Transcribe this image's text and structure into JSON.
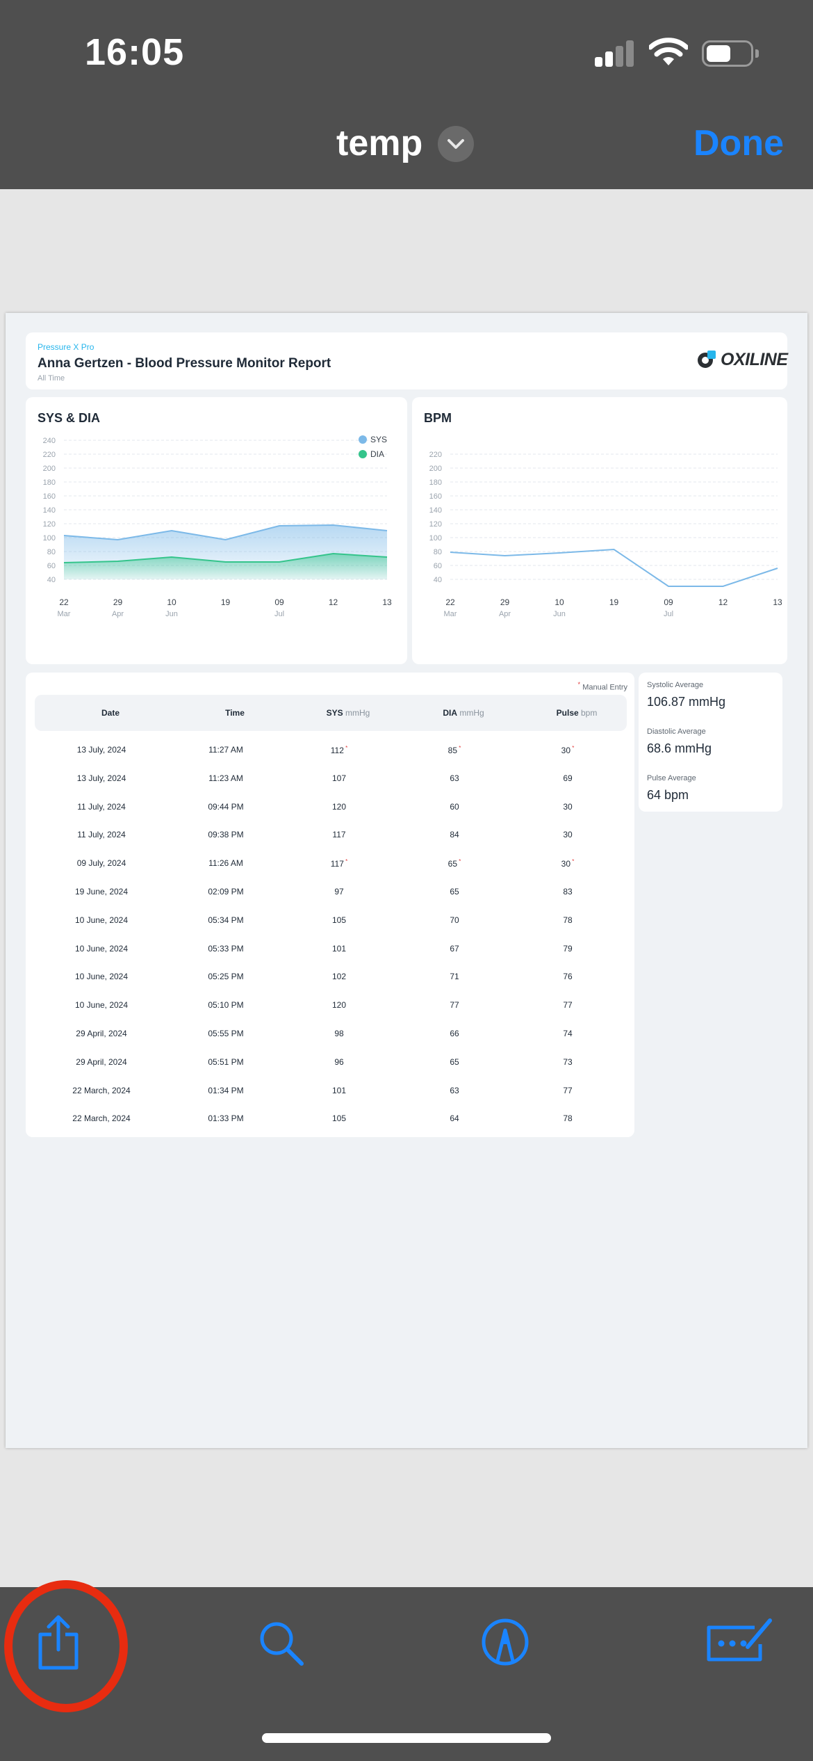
{
  "status_bar": {
    "time": "16:05"
  },
  "nav": {
    "title": "temp",
    "done_label": "Done"
  },
  "report": {
    "app_name": "Pressure X Pro",
    "title": "Anna Gertzen - Blood Pressure Monitor Report",
    "range": "All Time",
    "logo_text": "OXILINE",
    "manual_entry_note": "Manual Entry"
  },
  "chart_data": [
    {
      "type": "area",
      "title": "SYS & DIA",
      "y_ticks": [
        240,
        220,
        200,
        180,
        160,
        140,
        120,
        100,
        80,
        60,
        40
      ],
      "ylim": [
        40,
        240
      ],
      "x_ticks": [
        {
          "day": "22",
          "month": "Mar"
        },
        {
          "day": "29",
          "month": "Apr"
        },
        {
          "day": "10",
          "month": "Jun"
        },
        {
          "day": "19",
          "month": ""
        },
        {
          "day": "09",
          "month": "Jul"
        },
        {
          "day": "12",
          "month": ""
        },
        {
          "day": "13",
          "month": ""
        }
      ],
      "grid": true,
      "legend_position": "top-right",
      "series": [
        {
          "name": "SYS",
          "color": "#7cb9e8",
          "values": [
            103,
            97,
            110,
            97,
            117,
            118,
            110
          ]
        },
        {
          "name": "DIA",
          "color": "#34c48b",
          "values": [
            64,
            66,
            72,
            65,
            65,
            77,
            72
          ]
        }
      ]
    },
    {
      "type": "line",
      "title": "BPM",
      "y_ticks": [
        220,
        200,
        180,
        160,
        140,
        120,
        100,
        80,
        60,
        40
      ],
      "ylim": [
        40,
        220
      ],
      "x_ticks": [
        {
          "day": "22",
          "month": "Mar"
        },
        {
          "day": "29",
          "month": "Apr"
        },
        {
          "day": "10",
          "month": "Jun"
        },
        {
          "day": "19",
          "month": ""
        },
        {
          "day": "09",
          "month": "Jul"
        },
        {
          "day": "12",
          "month": ""
        },
        {
          "day": "13",
          "month": ""
        }
      ],
      "grid": true,
      "series": [
        {
          "color": "#7cb9e8",
          "values": [
            79,
            74,
            78,
            83,
            30,
            30,
            56
          ]
        }
      ]
    }
  ],
  "table": {
    "headers": [
      {
        "label": "Date",
        "unit": ""
      },
      {
        "label": "Time",
        "unit": ""
      },
      {
        "label": "SYS",
        "unit": "mmHg"
      },
      {
        "label": "DIA",
        "unit": "mmHg"
      },
      {
        "label": "Pulse",
        "unit": "bpm"
      }
    ],
    "rows": [
      {
        "date": "13 July, 2024",
        "time": "11:27 AM",
        "sys": "112",
        "dia": "85",
        "pulse": "30",
        "manual": true
      },
      {
        "date": "13 July, 2024",
        "time": "11:23 AM",
        "sys": "107",
        "dia": "63",
        "pulse": "69",
        "manual": false
      },
      {
        "date": "11 July, 2024",
        "time": "09:44 PM",
        "sys": "120",
        "dia": "60",
        "pulse": "30",
        "manual": false
      },
      {
        "date": "11 July, 2024",
        "time": "09:38 PM",
        "sys": "117",
        "dia": "84",
        "pulse": "30",
        "manual": false
      },
      {
        "date": "09 July, 2024",
        "time": "11:26 AM",
        "sys": "117",
        "dia": "65",
        "pulse": "30",
        "manual": true
      },
      {
        "date": "19 June, 2024",
        "time": "02:09 PM",
        "sys": "97",
        "dia": "65",
        "pulse": "83",
        "manual": false
      },
      {
        "date": "10 June, 2024",
        "time": "05:34 PM",
        "sys": "105",
        "dia": "70",
        "pulse": "78",
        "manual": false
      },
      {
        "date": "10 June, 2024",
        "time": "05:33 PM",
        "sys": "101",
        "dia": "67",
        "pulse": "79",
        "manual": false
      },
      {
        "date": "10 June, 2024",
        "time": "05:25 PM",
        "sys": "102",
        "dia": "71",
        "pulse": "76",
        "manual": false
      },
      {
        "date": "10 June, 2024",
        "time": "05:10 PM",
        "sys": "120",
        "dia": "77",
        "pulse": "77",
        "manual": false
      },
      {
        "date": "29 April, 2024",
        "time": "05:55 PM",
        "sys": "98",
        "dia": "66",
        "pulse": "74",
        "manual": false
      },
      {
        "date": "29 April, 2024",
        "time": "05:51 PM",
        "sys": "96",
        "dia": "65",
        "pulse": "73",
        "manual": false
      },
      {
        "date": "22 March, 2024",
        "time": "01:34 PM",
        "sys": "101",
        "dia": "63",
        "pulse": "77",
        "manual": false
      },
      {
        "date": "22 March, 2024",
        "time": "01:33 PM",
        "sys": "105",
        "dia": "64",
        "pulse": "78",
        "manual": false
      }
    ]
  },
  "averages": [
    {
      "label": "Systolic Average",
      "value": "106.87 mmHg"
    },
    {
      "label": "Diastolic Average",
      "value": "68.6 mmHg"
    },
    {
      "label": "Pulse Average",
      "value": "64 bpm"
    }
  ],
  "toolbar": {
    "accent": "#1a84ff",
    "items": [
      "share-icon",
      "search-icon",
      "markup-icon",
      "signature-icon"
    ]
  },
  "annotation_color": "#e82c10"
}
